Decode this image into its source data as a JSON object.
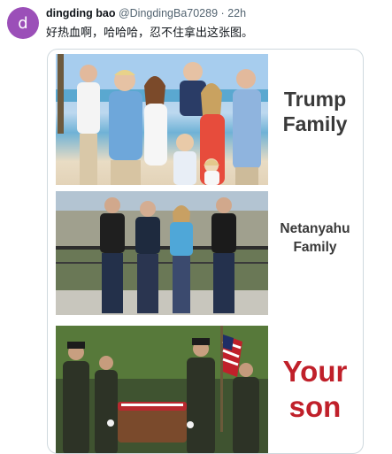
{
  "tweet": {
    "avatar_letter": "d",
    "author_name": "dingding bao",
    "author_handle": "@DingdingBa70289",
    "separator": "·",
    "time": "22h",
    "text": "好热血啊，哈哈哈，忍不住拿出这张图。"
  },
  "media": {
    "panels": [
      {
        "label_line1": "Trump",
        "label_line2": "Family"
      },
      {
        "label_line1": "Netanyahu",
        "label_line2": "Family"
      },
      {
        "label_line1": "Your",
        "label_line2": "son"
      }
    ]
  },
  "colors": {
    "avatar": "#9b4fb8",
    "label_dark": "#3a3a3a",
    "label_red": "#c0202a"
  }
}
